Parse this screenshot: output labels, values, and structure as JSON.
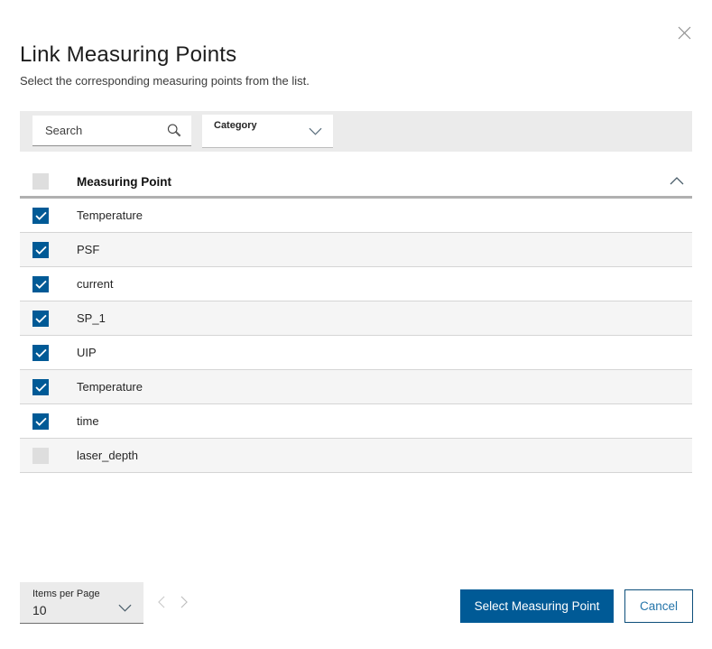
{
  "dialog": {
    "title": "Link Measuring Points",
    "subtitle": "Select the corresponding measuring points from the list."
  },
  "toolbar": {
    "search_placeholder": "Search",
    "category_label": "Category"
  },
  "table": {
    "header": {
      "label": "Measuring Point",
      "select_all_checked": false
    },
    "rows": [
      {
        "label": "Temperature",
        "checked": true
      },
      {
        "label": "PSF",
        "checked": true
      },
      {
        "label": "current",
        "checked": true
      },
      {
        "label": "SP_1",
        "checked": true
      },
      {
        "label": "UIP",
        "checked": true
      },
      {
        "label": "Temperature",
        "checked": true
      },
      {
        "label": "time",
        "checked": true
      },
      {
        "label": "laser_depth",
        "checked": false
      }
    ]
  },
  "footer": {
    "items_per_page_label": "Items per Page",
    "items_per_page_value": "10",
    "primary_button": "Select Measuring Point",
    "cancel_button": "Cancel"
  },
  "colors": {
    "accent_blue": "#005A96",
    "toolbar_bg": "#ebebeb",
    "row_alt_bg": "#f5f5f5",
    "checkbox_unchecked": "#dedede",
    "cancel_text": "#2575aa",
    "cancel_border": "#0d4f7b"
  }
}
